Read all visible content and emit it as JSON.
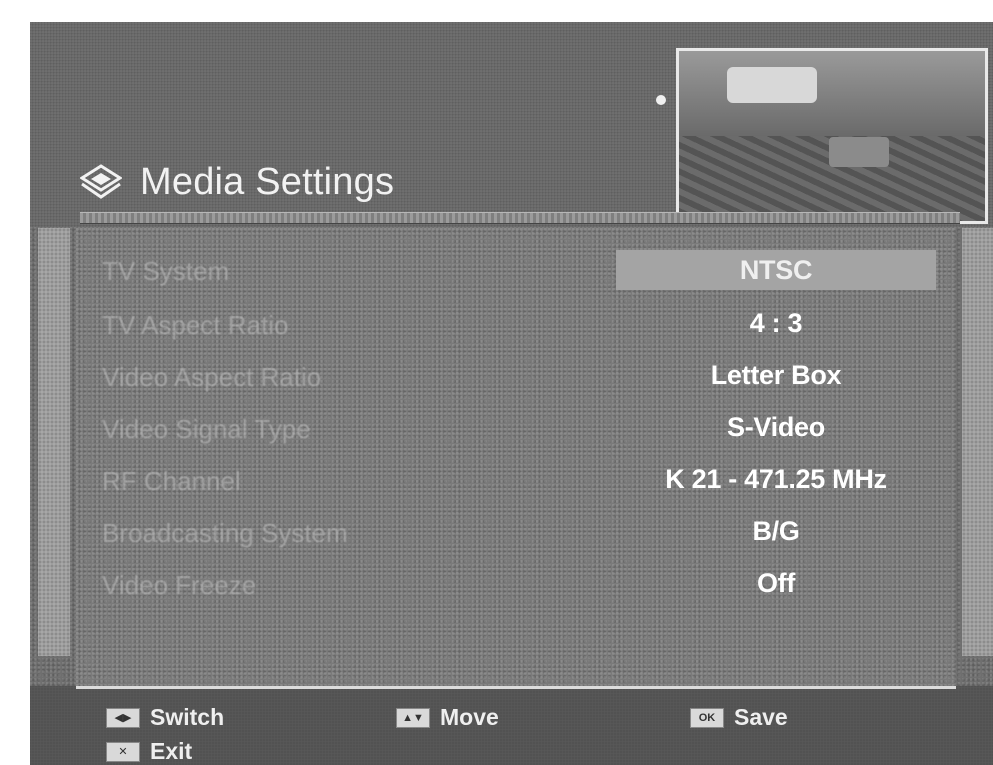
{
  "header": {
    "title": "Media Settings",
    "icon": "diamond-menu-icon"
  },
  "settings": [
    {
      "label": "TV System",
      "value": "NTSC",
      "selected": true
    },
    {
      "label": "TV Aspect Ratio",
      "value": "4 : 3"
    },
    {
      "label": "Video Aspect Ratio",
      "value": "Letter Box"
    },
    {
      "label": "Video Signal Type",
      "value": "S-Video"
    },
    {
      "label": "RF Channel",
      "value": "K 21 - 471.25 MHz"
    },
    {
      "label": "Broadcasting System",
      "value": "B/G"
    },
    {
      "label": "Video Freeze",
      "value": "Off"
    }
  ],
  "footer": {
    "keys": [
      {
        "label": "Switch",
        "icon": "switch-key-icon"
      },
      {
        "label": "Move",
        "icon": "move-key-icon"
      },
      {
        "label": "Save",
        "icon": "save-key-icon"
      },
      {
        "label": "Exit",
        "icon": "exit-key-icon"
      }
    ]
  },
  "colors": {
    "panel": "#7a7a7a",
    "highlight": "#a4a4a4",
    "text": "#ffffff"
  }
}
